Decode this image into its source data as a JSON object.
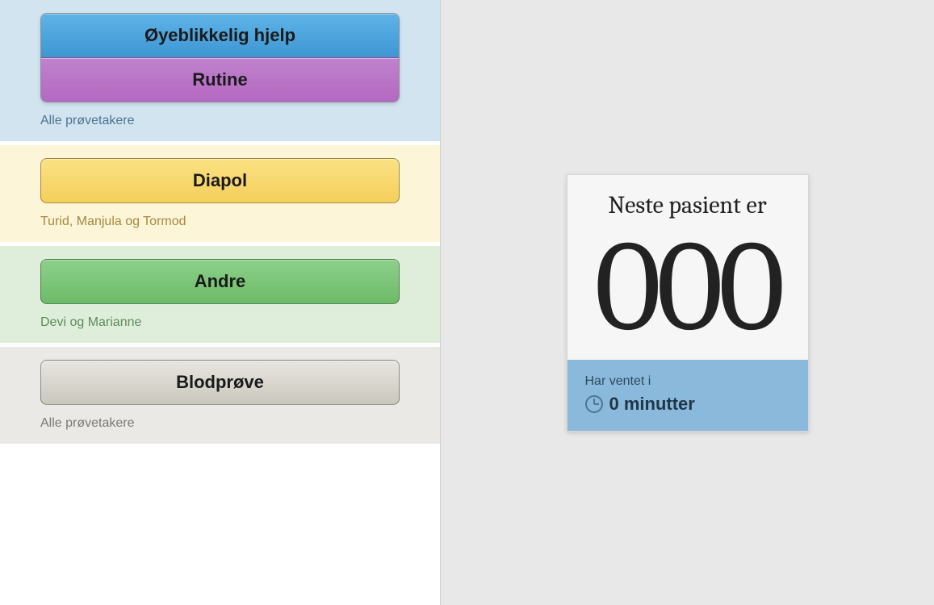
{
  "queues": [
    {
      "bg": "blue",
      "buttons": [
        {
          "label": "Øyeblikkelig hjelp",
          "style": "blue"
        },
        {
          "label": "Rutine",
          "style": "purple"
        }
      ],
      "subtitle": "Alle prøvetakere"
    },
    {
      "bg": "yellow",
      "buttons": [
        {
          "label": "Diapol",
          "style": "yellow"
        }
      ],
      "subtitle": "Turid, Manjula og Tormod"
    },
    {
      "bg": "green",
      "buttons": [
        {
          "label": "Andre",
          "style": "green"
        }
      ],
      "subtitle": "Devi og Marianne"
    },
    {
      "bg": "grey",
      "buttons": [
        {
          "label": "Blodprøve",
          "style": "grey"
        }
      ],
      "subtitle": "Alle prøvetakere"
    }
  ],
  "nextPatient": {
    "title": "Neste pasient er",
    "number": "000",
    "waitLabel": "Har ventet i",
    "waitValue": "0 minutter"
  }
}
